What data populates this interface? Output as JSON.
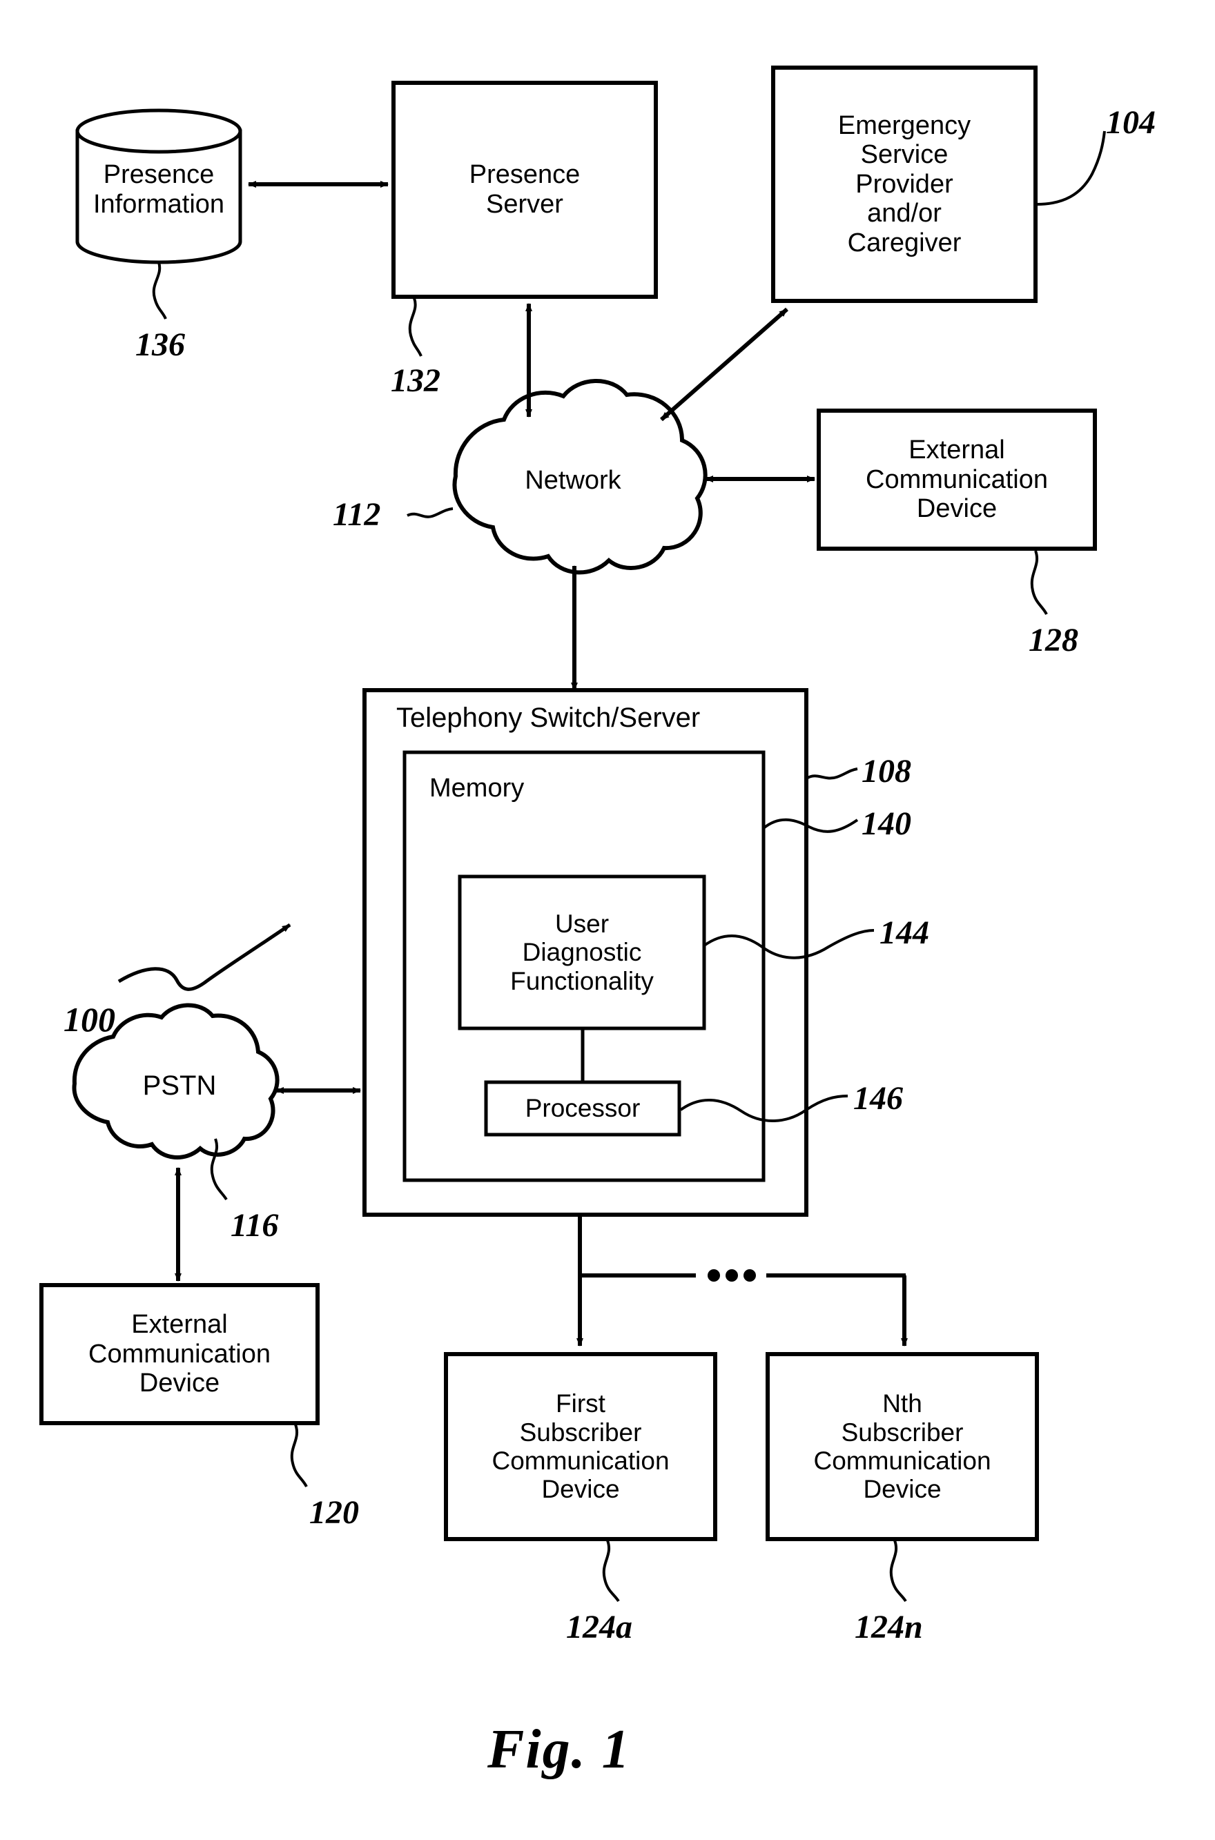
{
  "figure": {
    "caption": "Fig. 1",
    "system_ref": "100"
  },
  "nodes": [
    {
      "id": "presence-information",
      "label": "Presence\nInformation",
      "shape": "cylinder",
      "ref": "136"
    },
    {
      "id": "presence-server",
      "label": "Presence\nServer",
      "shape": "rect",
      "ref": "132"
    },
    {
      "id": "emergency-service-provider",
      "label": "Emergency\nService\nProvider\nand/or\nCaregiver",
      "shape": "rect",
      "ref": "104"
    },
    {
      "id": "network",
      "label": "Network",
      "shape": "cloud",
      "ref": "112"
    },
    {
      "id": "external-communication-device-top",
      "label": "External\nCommunication\nDevice",
      "shape": "rect",
      "ref": "128"
    },
    {
      "id": "telephony-switch-server",
      "label": "Telephony    Switch/Server",
      "shape": "rect",
      "ref": "108"
    },
    {
      "id": "memory",
      "label": "Memory",
      "shape": "rect",
      "ref": "140"
    },
    {
      "id": "user-diagnostic-functionality",
      "label": "User\nDiagnostic\nFunctionality",
      "shape": "rect",
      "ref": "144"
    },
    {
      "id": "processor",
      "label": "Processor",
      "shape": "rect",
      "ref": "146"
    },
    {
      "id": "pstn",
      "label": "PSTN",
      "shape": "cloud",
      "ref": "116"
    },
    {
      "id": "external-communication-device-bottom",
      "label": "External\nCommunication\nDevice",
      "shape": "rect",
      "ref": "120"
    },
    {
      "id": "first-subscriber-communication-device",
      "label": "First\nSubscriber\nCommunication\nDevice",
      "shape": "rect",
      "ref": "124a"
    },
    {
      "id": "nth-subscriber-communication-device",
      "label": "Nth\nSubscriber\nCommunication\nDevice",
      "shape": "rect",
      "ref": "124n"
    }
  ],
  "labels": {
    "presence_information": "Presence\nInformation",
    "presence_server": "Presence\nServer",
    "emergency_service_provider": "Emergency\nService\nProvider\nand/or\nCaregiver",
    "network": "Network",
    "external_comm_device_top": "External\nCommunication\nDevice",
    "telephony_switch_server": "Telephony    Switch/Server",
    "memory": "Memory",
    "user_diagnostic_functionality": "User\nDiagnostic\nFunctionality",
    "processor": "Processor",
    "pstn": "PSTN",
    "external_comm_device_bottom": "External\nCommunication\nDevice",
    "first_subscriber_device": "First\nSubscriber\nCommunication\nDevice",
    "nth_subscriber_device": "Nth\nSubscriber\nCommunication\nDevice"
  },
  "refs": {
    "system": "100",
    "emergency_service": "104",
    "telephony_switch": "108",
    "network": "112",
    "pstn": "116",
    "external_device_bottom": "120",
    "first_subscriber": "124a",
    "nth_subscriber": "124n",
    "external_device_top": "128",
    "presence_server": "132",
    "presence_information": "136",
    "memory": "140",
    "user_diagnostic": "144",
    "processor": "146"
  },
  "ellipsis": "•  •  •",
  "colors": {
    "stroke": "#000000",
    "background": "#ffffff"
  }
}
